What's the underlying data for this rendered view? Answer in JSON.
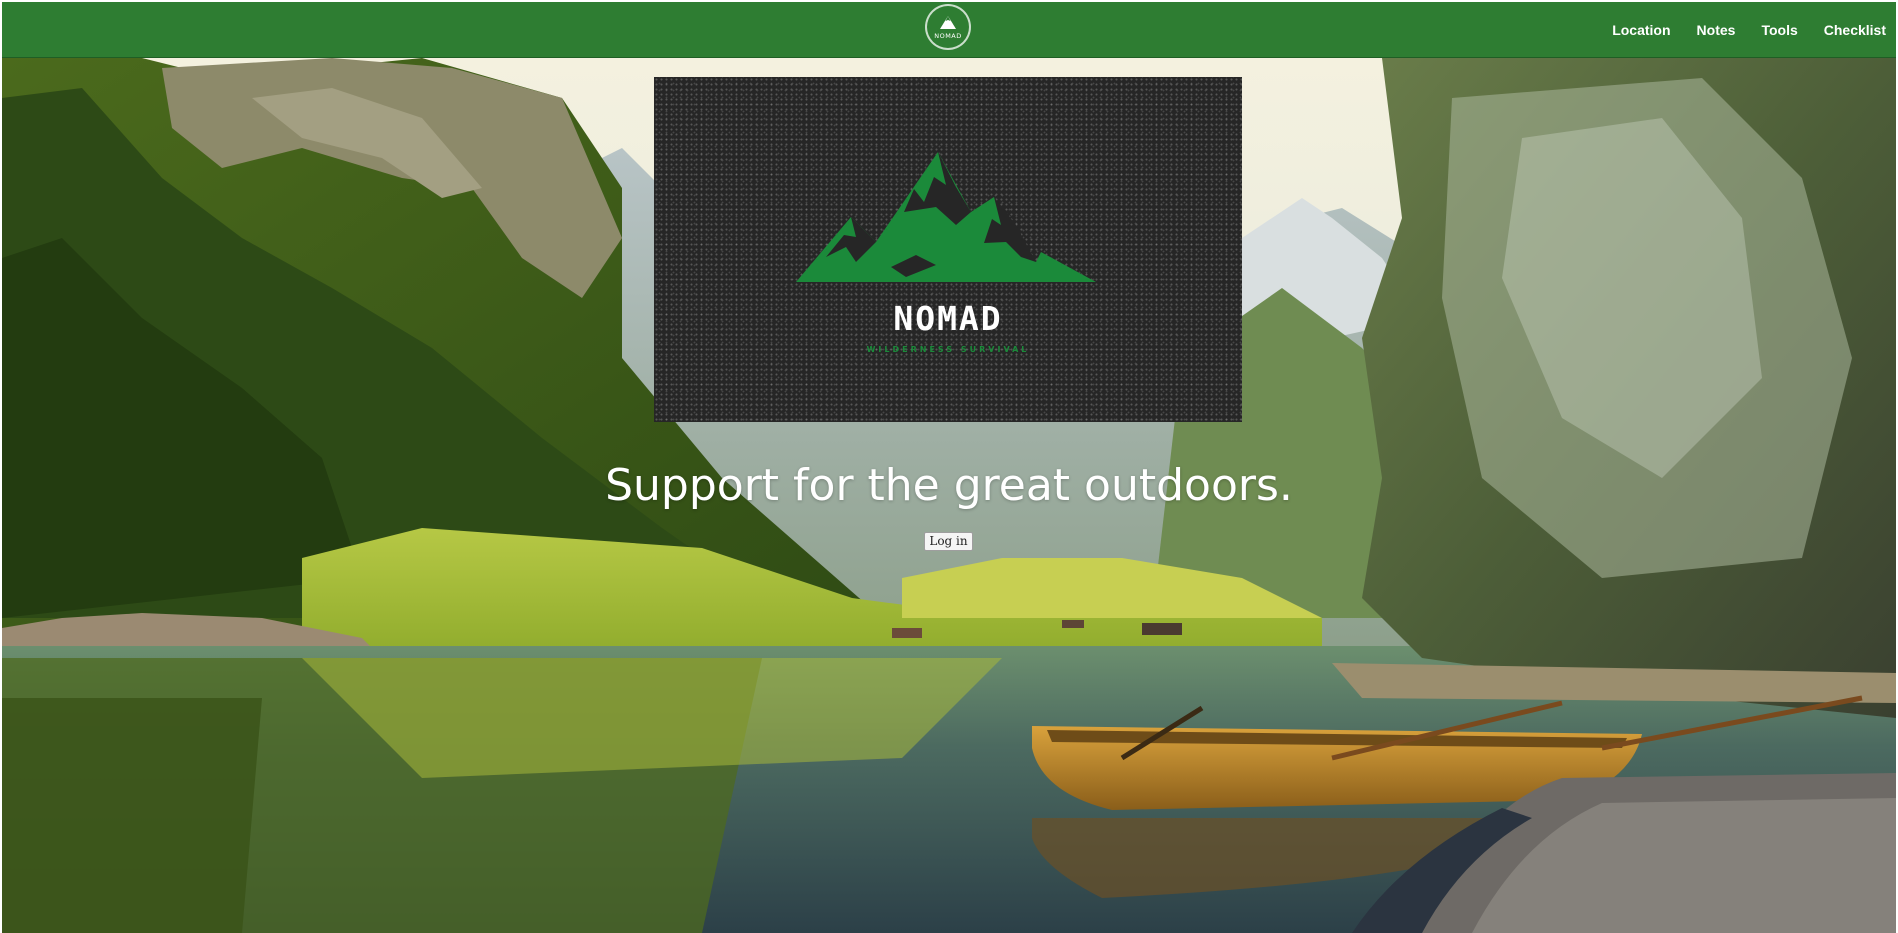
{
  "navbar": {
    "logo_text": "NOMAD",
    "links": [
      {
        "label": "Location"
      },
      {
        "label": "Notes"
      },
      {
        "label": "Tools"
      },
      {
        "label": "Checklist"
      }
    ],
    "background_color": "#2e7d32"
  },
  "brand": {
    "name": "NOMAD",
    "tagline": "WILDERNESS SURVIVAL",
    "mountain_color": "#1b8a3a",
    "card_color": "#262626"
  },
  "hero": {
    "headline": "Support for the great outdoors.",
    "login_label": "Log in"
  }
}
